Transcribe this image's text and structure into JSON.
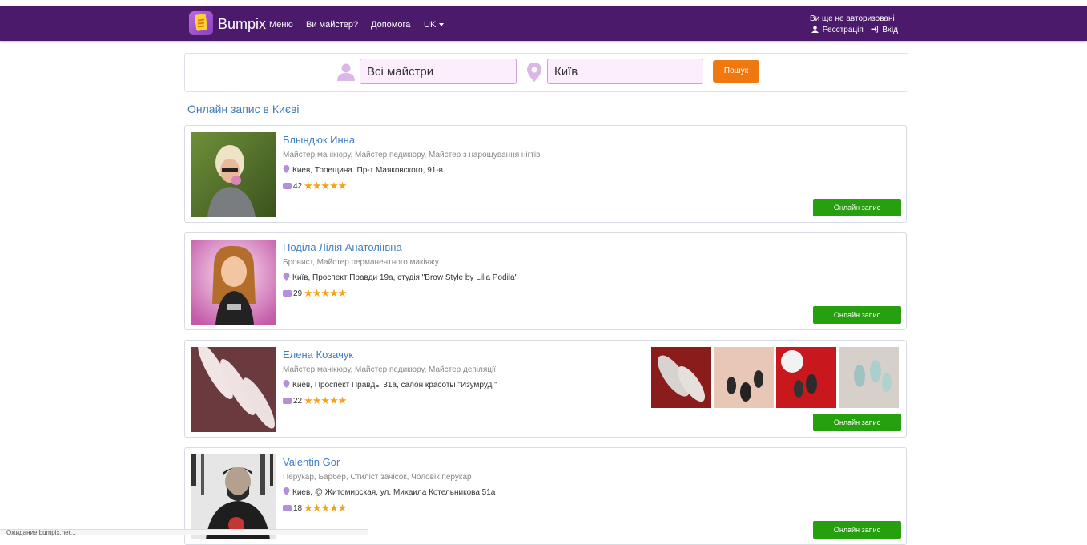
{
  "nav": {
    "brand": "Bumpix",
    "links": [
      "Меню",
      "Ви майстер?",
      "Допомога",
      "UK"
    ],
    "auth_title": "Ви ще не авторизовані",
    "register": "Реєстрація",
    "login": "Вхід",
    "bg_color": "#4b1a6b"
  },
  "search": {
    "master_value": "Всі майстри",
    "city_value": "Київ",
    "button": "Пошук",
    "button_color": "#f07810"
  },
  "section_title": "Онлайн запис в Києві",
  "masters": [
    {
      "name": "Блындюк Инна",
      "specialties": "Майстер манікюру, Майстер педикюру, Майстер з нарощування нігтів",
      "address": "Киев, Троещина. Пр-т Маяковского, 91-в.",
      "reviews": "42",
      "stars": "★★★★★",
      "button": "Онлайн запис"
    },
    {
      "name": "Поділа Лілія Анатоліївна",
      "specialties": "Бровист, Майстер перманентного макіяжу",
      "address": "Київ, Проспект Правди 19а, студія \"Brow Style by Lilia Podila\"",
      "reviews": "29",
      "stars": "★★★★★",
      "button": "Онлайн запис"
    },
    {
      "name": "Елена Козачук",
      "specialties": "Майстер манікюру, Майстер педикюру, Майстер депіляції",
      "address": "Киев, Проспект Правды 31а, салон красоты \"Изумруд \"",
      "reviews": "22",
      "stars": "★★★★★",
      "button": "Онлайн запис"
    },
    {
      "name": "Valentin Gor",
      "specialties": "Перукар, Барбер, Стиліст зачісок, Чоловік перукар",
      "address": "Киев, @ Житомирская, ул. Михаила Котельникова 51а",
      "reviews": "18",
      "stars": "★★★★★",
      "button": "Онлайн запис"
    }
  ],
  "status_bar": "Ожидание bumpix.net...",
  "colors": {
    "link": "#3f7fc2",
    "book_button": "#27a00f",
    "star": "#f6a21a"
  }
}
